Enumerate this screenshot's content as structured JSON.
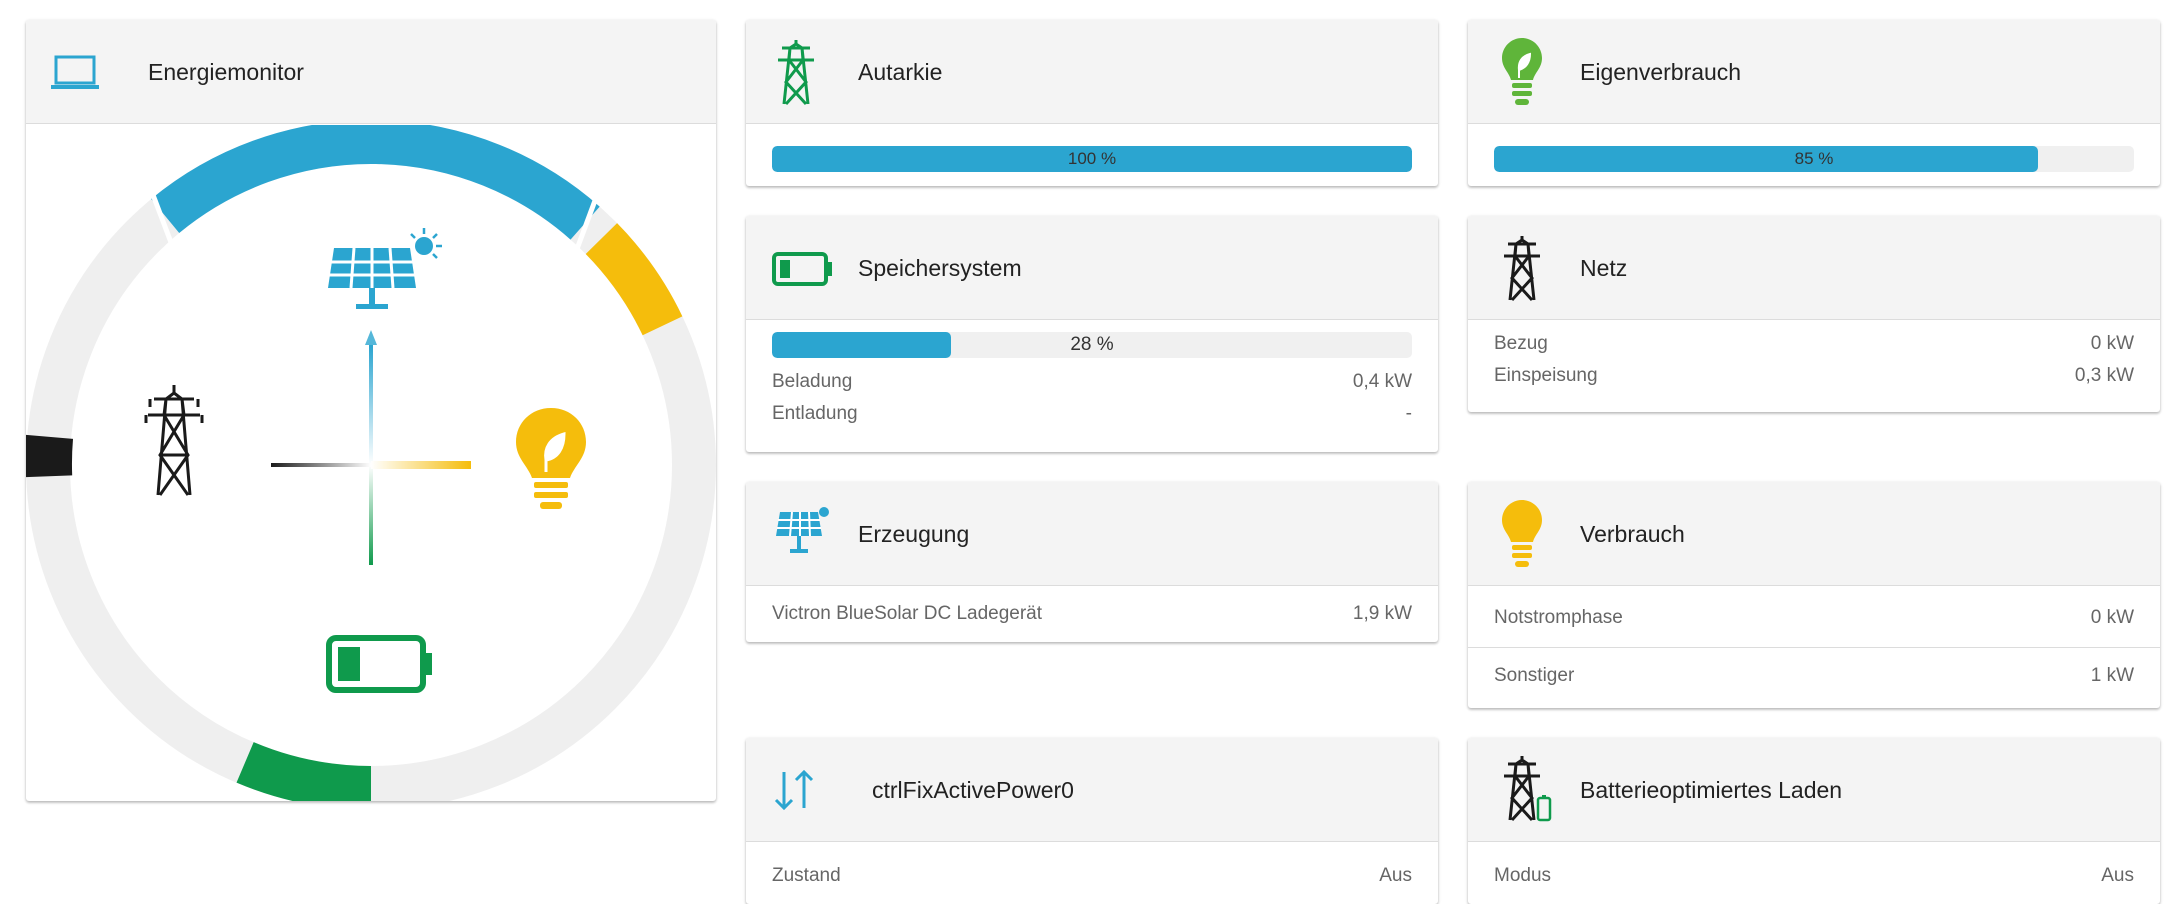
{
  "energiemonitor": {
    "title": "Energiemonitor"
  },
  "autarkie": {
    "title": "Autarkie",
    "percent_label": "100 %",
    "fill": 1.0
  },
  "eigenverbrauch": {
    "title": "Eigenverbrauch",
    "percent_label": "85 %",
    "fill": 0.85
  },
  "speichersystem": {
    "title": "Speichersystem",
    "percent_label": "28 %",
    "fill": 0.28,
    "rows": [
      {
        "label": "Beladung",
        "value": "0,4 kW"
      },
      {
        "label": "Entladung",
        "value": "-"
      }
    ]
  },
  "netz": {
    "title": "Netz",
    "rows": [
      {
        "label": "Bezug",
        "value": "0 kW"
      },
      {
        "label": "Einspeisung",
        "value": "0,3 kW"
      }
    ]
  },
  "erzeugung": {
    "title": "Erzeugung",
    "rows": [
      {
        "label": "Victron BlueSolar DC Ladegerät",
        "value": "1,9 kW"
      }
    ]
  },
  "verbrauch": {
    "title": "Verbrauch",
    "rows": [
      {
        "label": "Notstromphase",
        "value": "0 kW"
      },
      {
        "label": "Sonstiger",
        "value": "1 kW"
      }
    ]
  },
  "ctrl": {
    "title": "ctrlFixActivePower0",
    "rows": [
      {
        "label": "Zustand",
        "value": "Aus"
      }
    ]
  },
  "batterieladen": {
    "title": "Batterieoptimiertes Laden",
    "rows": [
      {
        "label": "Modus",
        "value": "Aus"
      }
    ]
  },
  "colors": {
    "blue": "#2ba5d0",
    "yellow": "#f5bd0c",
    "green": "#0f9a4c",
    "black": "#1a1a1a",
    "grey_track": "#efefef",
    "header_bg": "#f4f4f4"
  }
}
